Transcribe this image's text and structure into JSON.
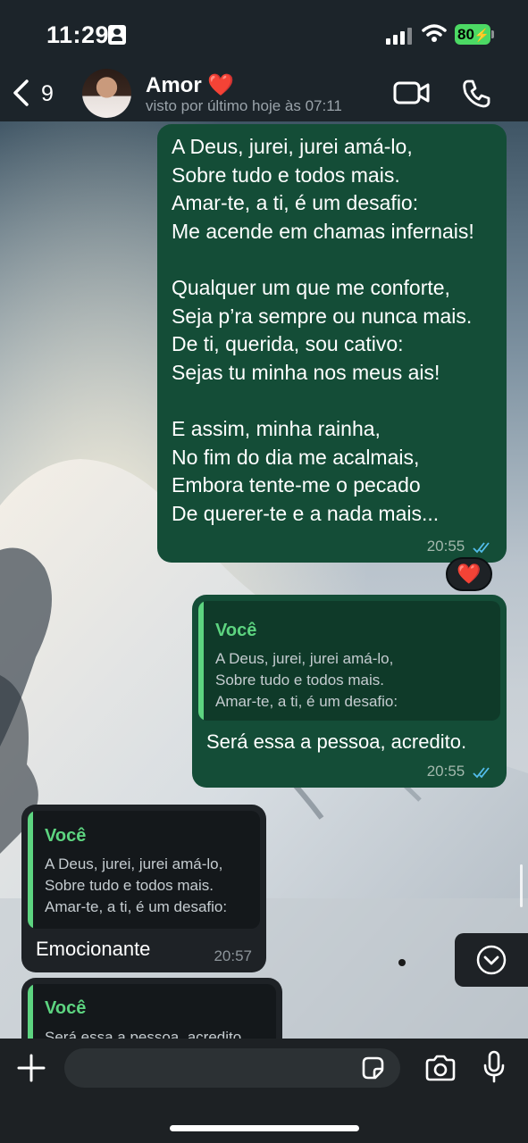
{
  "status_bar": {
    "time": "11:29",
    "battery": "80"
  },
  "header": {
    "back_count": "9",
    "contact_name": "Amor ❤️",
    "last_seen": "visto por último hoje às 07:11"
  },
  "messages": [
    {
      "direction": "outgoing",
      "text": "A Deus, jurei, jurei amá-lo,\nSobre tudo e todos mais.\nAmar-te, a ti, é um desafio:\nMe acende em chamas infernais!\n\nQualquer um que me conforte,\nSeja p’ra sempre ou nunca mais.\nDe ti, querida, sou cativo:\nSejas tu minha nos meus ais!\n\nE assim, minha rainha,\nNo fim do dia me acalmais,\nEmbora tente-me o pecado\nDe querer-te e a nada mais...",
      "time": "20:55",
      "reaction": "❤️"
    },
    {
      "direction": "outgoing",
      "quote_author": "Você",
      "quote_text": "A Deus, jurei, jurei amá-lo,\nSobre tudo e todos mais.\nAmar-te, a ti, é um desafio:",
      "text": "Será essa a pessoa, acredito.",
      "time": "20:55"
    },
    {
      "direction": "incoming",
      "quote_author": "Você",
      "quote_text": "A Deus, jurei, jurei amá-lo,\nSobre tudo e todos mais.\nAmar-te, a ti, é um desafio:",
      "text": "Emocionante",
      "time": "20:57"
    },
    {
      "direction": "incoming",
      "quote_author": "Você",
      "quote_text": "Será essa a pessoa, acredito."
    }
  ],
  "icons": {
    "back": "chevron-left-icon",
    "video": "video-camera-icon",
    "phone": "phone-icon",
    "plus": "plus-icon",
    "sticker": "sticker-icon",
    "camera": "camera-icon",
    "mic": "microphone-icon",
    "scroll": "chevron-down-circle-icon"
  },
  "colors": {
    "outgoing_bubble": "#144d37",
    "incoming_bubble": "#1e2226",
    "quote_accent": "#5dd480",
    "read_ticks": "#53bdeb"
  }
}
